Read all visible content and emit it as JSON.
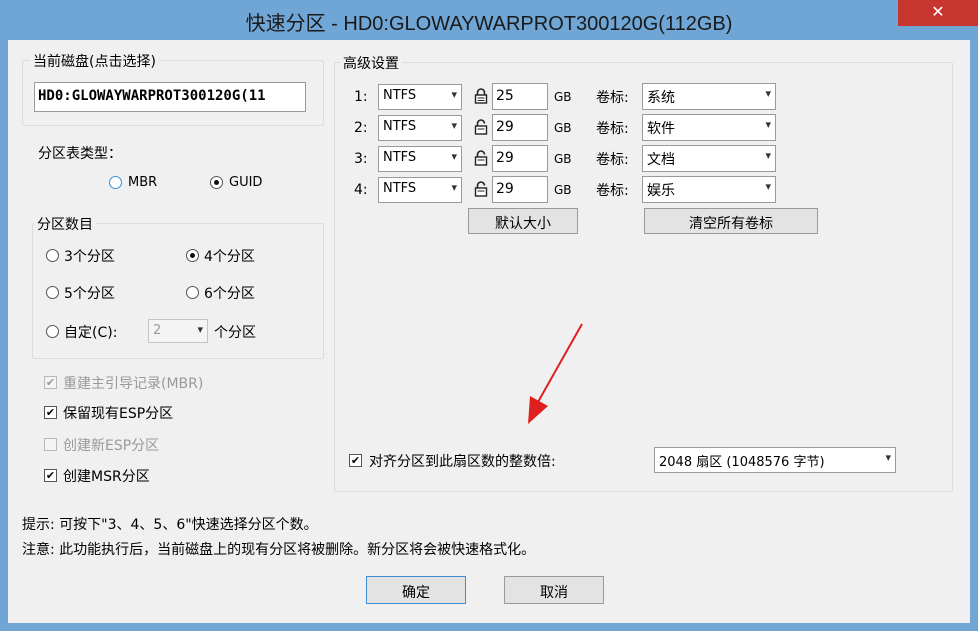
{
  "window": {
    "title": "快速分区 - HD0:GLOWAYWARPROT300120G(112GB)",
    "close_symbol": "✕"
  },
  "disk_group": {
    "label": "当前磁盘(点击选择)",
    "value": "HD0:GLOWAYWARPROT300120G(11"
  },
  "partition_table": {
    "label": "分区表类型：",
    "options": [
      "MBR",
      "GUID"
    ],
    "selected": "GUID"
  },
  "partition_count": {
    "label": "分区数目",
    "options": [
      "3个分区",
      "4个分区",
      "5个分区",
      "6个分区"
    ],
    "selected": "4个分区",
    "custom_label": "自定(C):",
    "custom_value": "2",
    "custom_suffix": "个分区"
  },
  "checkboxes": [
    {
      "label": "重建主引导记录(MBR)",
      "checked": true,
      "enabled": false
    },
    {
      "label": "保留现有ESP分区",
      "checked": true,
      "enabled": true
    },
    {
      "label": "创建新ESP分区",
      "checked": false,
      "enabled": false
    },
    {
      "label": "创建MSR分区",
      "checked": true,
      "enabled": true
    }
  ],
  "advanced": {
    "label": "高级设置",
    "unit": "GB",
    "volume_label_caption": "卷标:",
    "rows": [
      {
        "index": "1:",
        "fs": "NTFS",
        "size": "25",
        "locked": true,
        "volume": "系统"
      },
      {
        "index": "2:",
        "fs": "NTFS",
        "size": "29",
        "locked": false,
        "volume": "软件"
      },
      {
        "index": "3:",
        "fs": "NTFS",
        "size": "29",
        "locked": false,
        "volume": "文档"
      },
      {
        "index": "4:",
        "fs": "NTFS",
        "size": "29",
        "locked": false,
        "volume": "娱乐"
      }
    ],
    "default_size_button": "默认大小",
    "clear_labels_button": "清空所有卷标",
    "align_label": "对齐分区到此扇区数的整数倍:",
    "align_checked": true,
    "align_value": "2048 扇区 (1048576 字节)"
  },
  "hints": {
    "tip": "提示: 可按下\"3、4、5、6\"快速选择分区个数。",
    "warning": "注意: 此功能执行后，当前磁盘上的现有分区将被删除。新分区将会被快速格式化。"
  },
  "buttons": {
    "ok": "确定",
    "cancel": "取消"
  },
  "colors": {
    "titlebar": "#6fa6d6",
    "close": "#c7362e",
    "annotation_arrow": "#e02020"
  }
}
